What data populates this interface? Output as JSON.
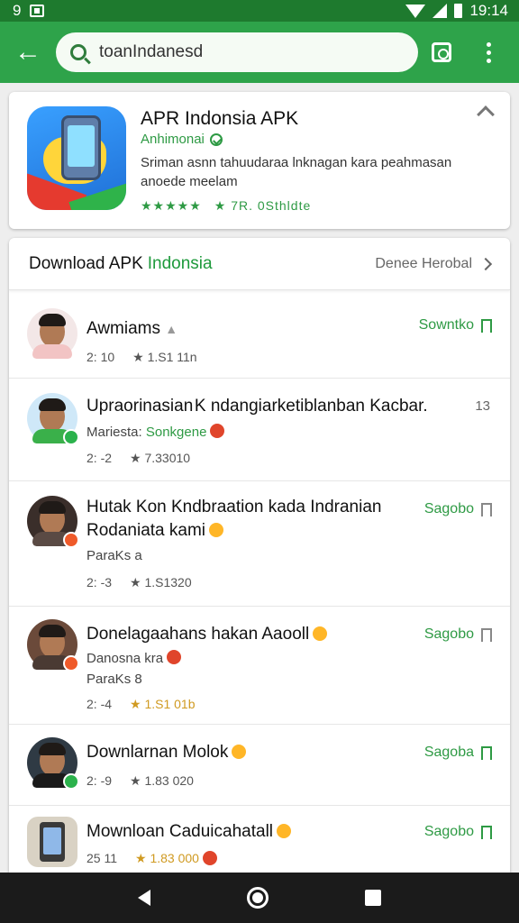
{
  "status_bar": {
    "left_text": "9",
    "time": "19:14"
  },
  "search": {
    "value": "toanIndanesd",
    "icon": "search-icon"
  },
  "featured": {
    "title": "APR Indonsia APK",
    "developer": "Anhimonai",
    "description": "Sriman asnn tahuudaraa lnknagan kara peahmasan anoede meelam",
    "stars": "★★★★★",
    "rating_text": "★ 7R. 0Sthldte"
  },
  "list_header": {
    "title": "Download APK",
    "accent": "Indonsia",
    "more": "Denee Herobal"
  },
  "items": [
    {
      "title": "Awmiams",
      "subtitle": "",
      "meta_left": "2: 10",
      "meta_right": "★ 1.S1 11n",
      "action": "Sowntko",
      "count": ""
    },
    {
      "title": "Upraorinasian K ndangiarketiblanban Kacbar.",
      "subtitle_label": "Mariesta:",
      "subtitle_green": "Sonkgene",
      "meta_left": "2: -2",
      "meta_right": "★ 7.33010",
      "action": "",
      "count": "13"
    },
    {
      "title": "Hutak Kon Kndbraation kada Indranian Rodaniata kami",
      "subtitle": "ParaKs a",
      "meta_left": "2: -3",
      "meta_right": "★ 1.S1320",
      "action": "Sagobo",
      "count": ""
    },
    {
      "title": "Donelagaahans hakan Aaooll",
      "subtitle": "Danosna kra",
      "subtitle2": "ParaKs 8",
      "meta_left": "2: -4",
      "meta_right": "★ 1.S1 01b",
      "action": "Sagobo",
      "count": ""
    },
    {
      "title": "Downlarnan Molok",
      "subtitle": "",
      "meta_left": "2: -9",
      "meta_right": "★ 1.83 020",
      "action": "Sagoba",
      "count": ""
    },
    {
      "title": "Mownloan Caduicahatall",
      "subtitle": "",
      "meta_left": "25 11",
      "meta_right": "★ 1.83 000",
      "action": "Sagobo",
      "count": ""
    }
  ],
  "colors": {
    "status_bar": "#1e7a2e",
    "app_bar": "#2ea34a",
    "accent": "#2e9a44",
    "nav_bar": "#1b1b1b"
  }
}
